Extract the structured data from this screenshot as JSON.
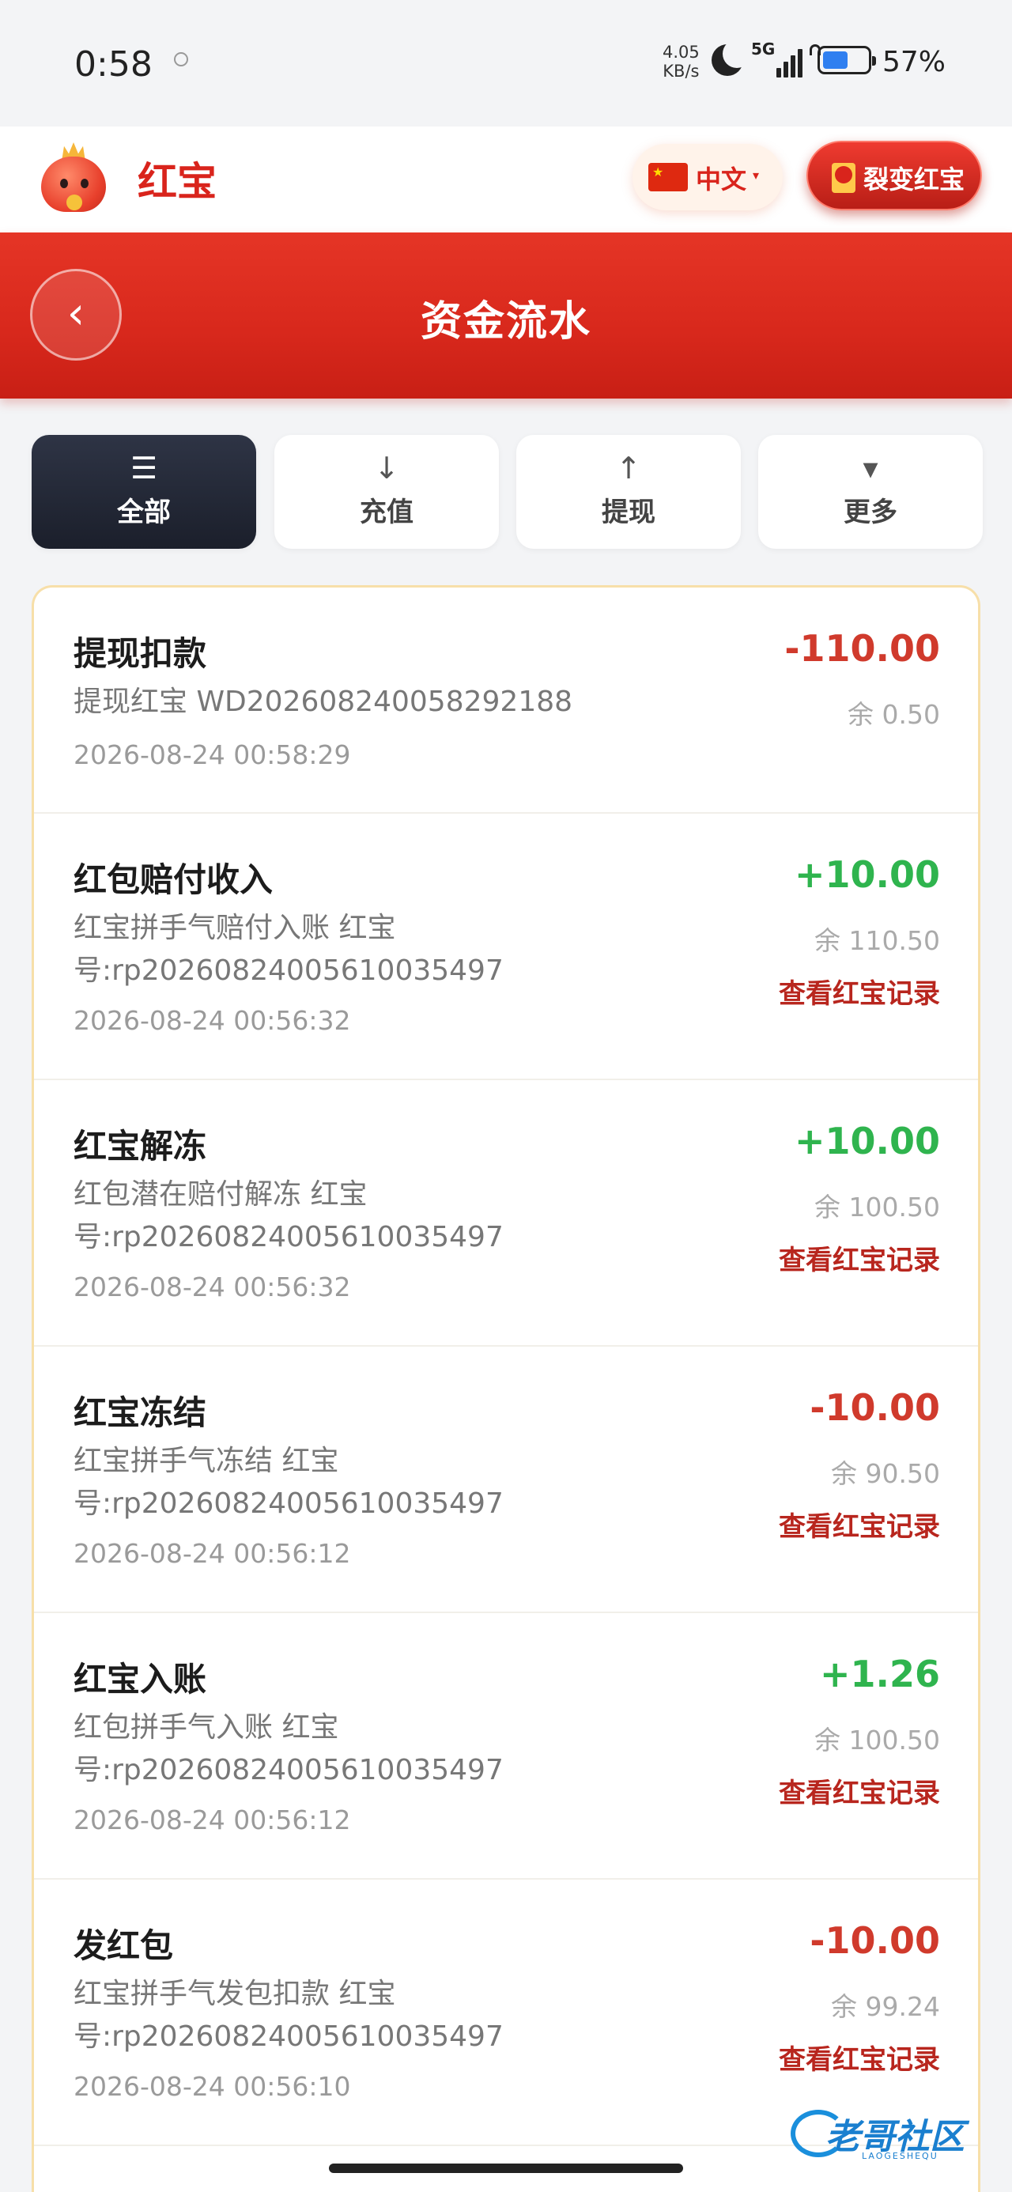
{
  "status_bar": {
    "time": "0:58",
    "net_speed_value": "4.05",
    "net_speed_unit": "KB/s",
    "network": "5G",
    "battery": "57%",
    "battery_level": 0.57
  },
  "header": {
    "app_name": "红宝",
    "language": "中文",
    "fission_button": "裂变红宝"
  },
  "banner": {
    "back_label": "‹",
    "title": "资金流水"
  },
  "tabs": [
    {
      "icon": "☰",
      "label": "全部",
      "active": true
    },
    {
      "icon": "↓",
      "label": "充值",
      "active": false
    },
    {
      "icon": "↑",
      "label": "提现",
      "active": false
    },
    {
      "icon": "▾",
      "label": "更多",
      "active": false
    }
  ],
  "transactions": [
    {
      "title": "提现扣款",
      "desc": "提现红宝 WD20260824005829​2188",
      "time": "2026-08-24 00:58:29",
      "amount": "-110.00",
      "balance": "余 0.50",
      "link": ""
    },
    {
      "title": "红包赔付收入",
      "desc": "红宝拼手气赔付入账 红宝号:rp20260824005610035497",
      "time": "2026-08-24 00:56:32",
      "amount": "+10.00",
      "balance": "余 110.50",
      "link": "查看红宝记录"
    },
    {
      "title": "红宝解冻",
      "desc": "红包潜在赔付解冻 红宝号:rp20260824005610035497",
      "time": "2026-08-24 00:56:32",
      "amount": "+10.00",
      "balance": "余 100.50",
      "link": "查看红宝记录"
    },
    {
      "title": "红宝冻结",
      "desc": "红宝拼手气冻结 红宝号:rp20260824005610035497",
      "time": "2026-08-24 00:56:12",
      "amount": "-10.00",
      "balance": "余 90.50",
      "link": "查看红宝记录"
    },
    {
      "title": "红宝入账",
      "desc": "红包拼手气入账 红宝号:rp20260824005610035497",
      "time": "2026-08-24 00:56:12",
      "amount": "+1.26",
      "balance": "余 100.50",
      "link": "查看红宝记录"
    },
    {
      "title": "发红包",
      "desc": "红宝拼手气发包扣款 红宝号:rp20260824005610035497",
      "time": "2026-08-24 00:56:10",
      "amount": "-10.00",
      "balance": "余 99.24",
      "link": "查看红宝记录"
    }
  ],
  "watermark": {
    "text": "老哥社区",
    "sub": "LAOGESHEQU"
  }
}
